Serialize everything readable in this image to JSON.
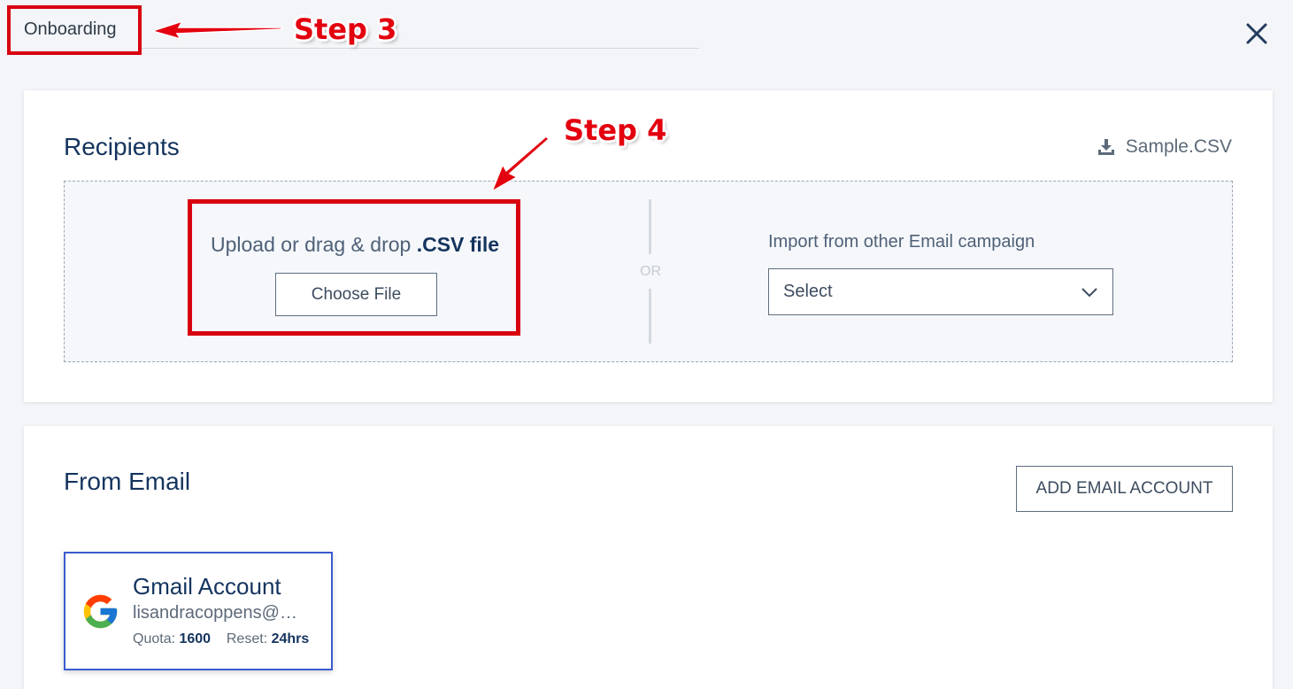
{
  "header": {
    "title": "Onboarding"
  },
  "annotations": {
    "step3": "Step 3",
    "step4": "Step 4",
    "accent": "#d8000f"
  },
  "recipients": {
    "title": "Recipients",
    "sample_link": "Sample.CSV",
    "upload_text": "Upload or drag & drop",
    "upload_ext": ".CSV file",
    "choose_file_label": "Choose File",
    "or_label": "OR",
    "import_label": "Import from other Email campaign",
    "select_value": "Select"
  },
  "from_email": {
    "title": "From Email",
    "add_button": "ADD EMAIL ACCOUNT",
    "account": {
      "name": "Gmail Account",
      "email": "lisandracoppens@…",
      "quota_label": "Quota:",
      "quota_value": "1600",
      "reset_label": "Reset:",
      "reset_value": "24hrs"
    }
  },
  "icons": [
    "close-icon",
    "download-icon",
    "chevron-down-icon",
    "google-icon"
  ]
}
